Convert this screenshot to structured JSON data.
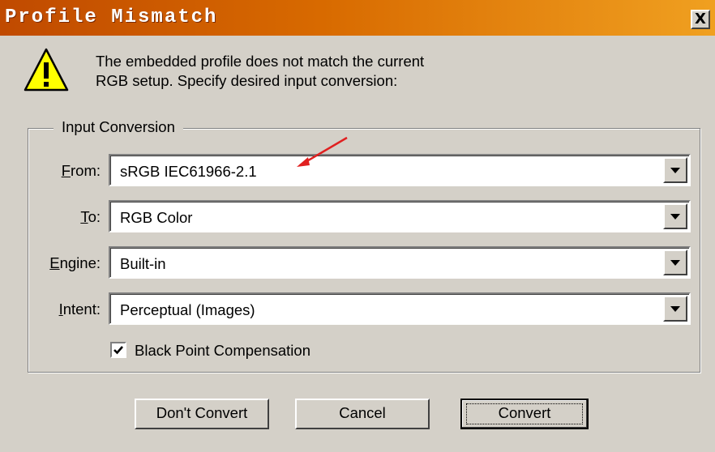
{
  "window": {
    "title": "Profile Mismatch",
    "close_glyph": "X"
  },
  "message": {
    "icon": "warning-icon",
    "line1": "The embedded profile does not match the current",
    "line2": "RGB setup.  Specify desired input conversion:"
  },
  "group": {
    "legend": "Input Conversion"
  },
  "fields": {
    "from": {
      "label_u": "F",
      "label_rest": "rom:",
      "value": "sRGB IEC61966-2.1"
    },
    "to": {
      "label_u": "T",
      "label_rest": "o:",
      "value": "RGB Color"
    },
    "engine": {
      "label_u": "E",
      "label_rest": "ngine:",
      "value": "Built-in"
    },
    "intent": {
      "label_u": "I",
      "label_rest": "ntent:",
      "value": "Perceptual (Images)"
    }
  },
  "checkbox": {
    "label": "Black Point Compensation",
    "checked": true
  },
  "buttons": {
    "dont_convert": "Don't Convert",
    "cancel": "Cancel",
    "convert": "Convert"
  },
  "colors": {
    "title_gradient_start": "#c04a00",
    "title_gradient_end": "#f0a020",
    "annotation_arrow": "#e02020",
    "dialog_face": "#d4d0c8"
  }
}
